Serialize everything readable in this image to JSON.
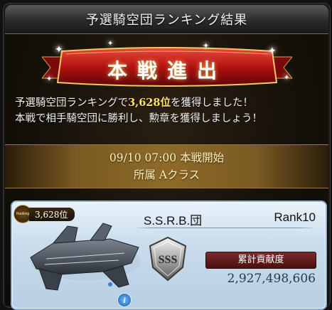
{
  "window": {
    "title": "予選騎空団ランキング結果"
  },
  "banner": {
    "text": "本戦進出"
  },
  "message": {
    "line1_prefix": "予選騎空団ランキングで",
    "line1_rank": "3,628位",
    "line1_suffix": "を獲得しました！",
    "line2": "本戦で相手騎空団に勝利し、勲章を獲得しましょう！"
  },
  "schedule": {
    "start": "09/10 07:00 本戦開始",
    "class": "所属 Aクラス"
  },
  "crew_card": {
    "ranking_badge": "Ranking",
    "rank": "3,628位",
    "name": "S.S.R.B.団",
    "rank_label": "Rank10",
    "emblem": "SSS",
    "contribution_label": "累計貢献度",
    "contribution_value": "2,927,498,606",
    "info_icon_symbol": "i"
  },
  "colors": {
    "highlight": "#ffe266",
    "banner_red": "#b31212",
    "gold_band": "#8e6a2a",
    "contribution_label_bg": "#6a1f1f"
  },
  "icons": [
    "ranking-medal-icon",
    "airship-image",
    "sss-emblem-icon",
    "info-icon",
    "sparkle-icon"
  ]
}
